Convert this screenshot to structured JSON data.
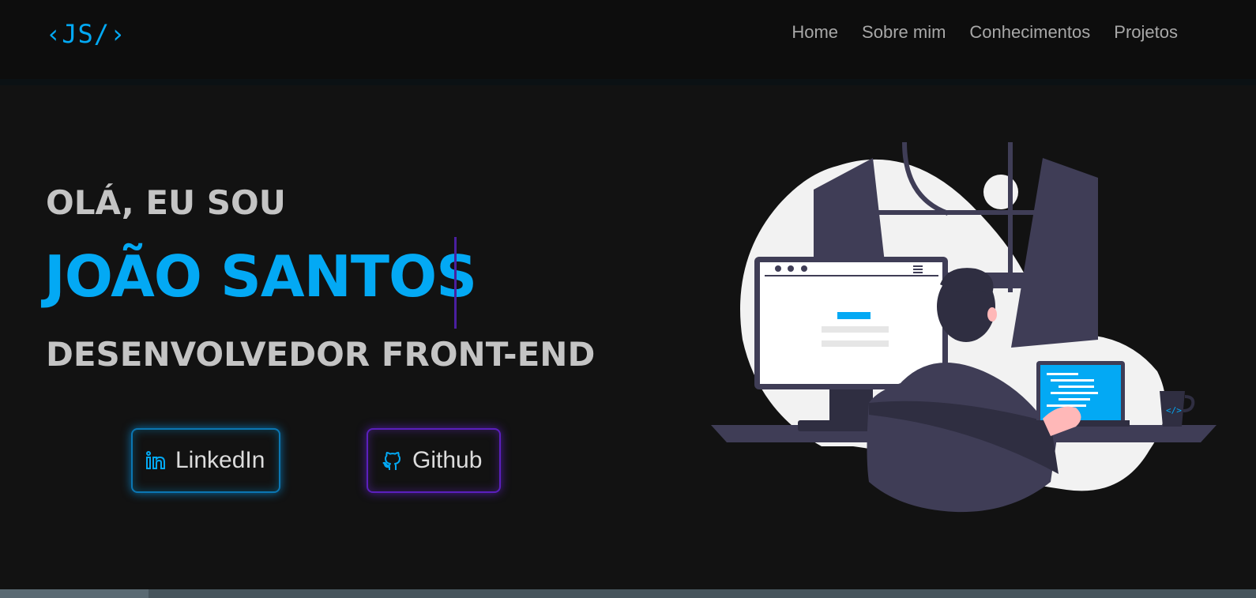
{
  "header": {
    "logo": "‹JS/›",
    "nav": [
      "Home",
      "Sobre mim",
      "Conhecimentos",
      "Projetos"
    ]
  },
  "hero": {
    "greeting": "OLÁ, EU SOU",
    "name": "JOÃO SANTOS",
    "role": "DESENVOLVEDOR FRONT-END",
    "buttons": {
      "linkedin": "LinkedIn",
      "github": "Github"
    }
  },
  "colors": {
    "accent": "#03a9f4",
    "purple": "#5b1fbd",
    "background": "#121212",
    "text": "#c4c4c4"
  },
  "icons": {
    "linkedin": "linkedin-icon",
    "github": "github-icon",
    "code_mug": "code-icon"
  }
}
